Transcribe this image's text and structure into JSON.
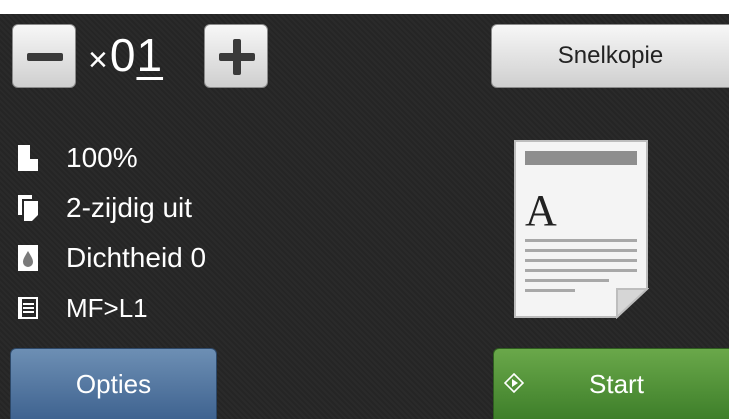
{
  "copies": {
    "times_symbol": "×",
    "digit_1": "0",
    "digit_2": "1"
  },
  "buttons": {
    "minus_icon": "minus-icon",
    "plus_icon": "plus-icon",
    "quick_copy_label": "Snelkopie",
    "options_label": "Opties",
    "start_label": "Start"
  },
  "settings": [
    {
      "icon": "enlarge-reduce-icon",
      "label": "100%"
    },
    {
      "icon": "duplex-icon",
      "label": "2-zijdig uit"
    },
    {
      "icon": "density-icon",
      "label": "Dichtheid 0"
    },
    {
      "icon": "tray-icon",
      "label": "MF>L1"
    }
  ],
  "preview": {
    "letter": "A"
  },
  "colors": {
    "background": "#262626",
    "options_button": "#4f739f",
    "start_button": "#52963a"
  }
}
